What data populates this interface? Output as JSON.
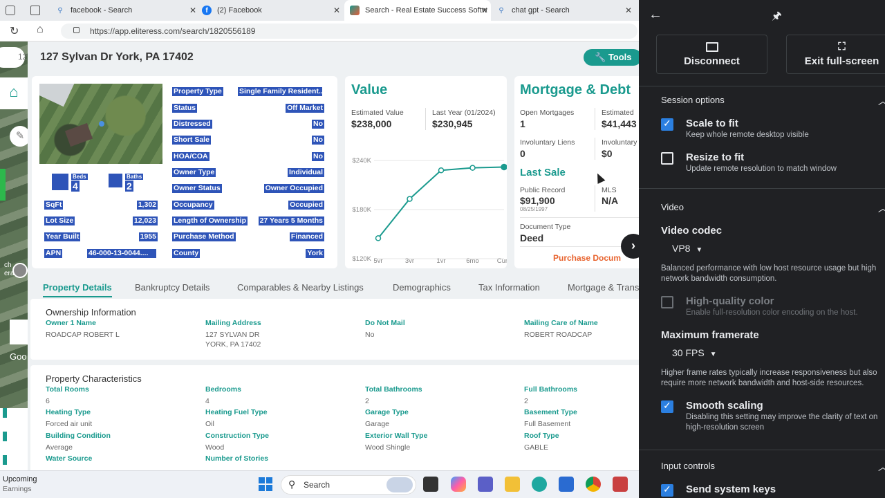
{
  "browser": {
    "tabs": [
      {
        "label": "facebook - Search",
        "icon": "search-icon"
      },
      {
        "label": "(2) Facebook",
        "icon": "facebook-icon"
      },
      {
        "label": "Search - Real Estate Success Softw",
        "icon": "elite-logo-icon"
      },
      {
        "label": "chat gpt - Search",
        "icon": "search-icon"
      }
    ],
    "url": "https://app.eliteress.com/search/1820556189"
  },
  "property": {
    "address": "127 Sylvan Dr York, PA 17402",
    "tools_label": "Tools",
    "beds_label": "Beds",
    "beds": "4",
    "baths_label": "Baths",
    "baths": "2",
    "left_rows": [
      {
        "label": "SqFt",
        "value": "1,302"
      },
      {
        "label": "Lot Size",
        "value": "12,023"
      },
      {
        "label": "Year Built",
        "value": "1955"
      },
      {
        "label": "APN",
        "value": "46-000-13-0044...."
      }
    ],
    "right_rows": [
      {
        "label": "Property Type",
        "value": "Single Family Resident..."
      },
      {
        "label": "Status",
        "value": "Off Market"
      },
      {
        "label": "Distressed",
        "value": "No"
      },
      {
        "label": "Short Sale",
        "value": "No"
      },
      {
        "label": "HOA/COA",
        "value": "No"
      },
      {
        "label": "Owner Type",
        "value": "Individual"
      },
      {
        "label": "Owner Status",
        "value": "Owner Occupied"
      },
      {
        "label": "Occupancy",
        "value": "Occupied"
      },
      {
        "label": "Length of Ownership",
        "value": "27 Years 5 Months"
      },
      {
        "label": "Purchase Method",
        "value": "Financed"
      },
      {
        "label": "County",
        "value": "York"
      }
    ]
  },
  "value_card": {
    "title": "Value",
    "est_label": "Estimated Value",
    "est_value": "$238,000",
    "last_label": "Last Year (01/2024)",
    "last_value": "$230,945"
  },
  "chart_data": {
    "type": "line",
    "categories": [
      "5yr",
      "3yr",
      "1yr",
      "6mo",
      "Curr."
    ],
    "values": [
      145000,
      193000,
      228000,
      231000,
      232000
    ],
    "yticks": [
      "$240K",
      "$180K",
      "$120K"
    ],
    "ylim": [
      120000,
      240000
    ],
    "color": "#1a9a8e"
  },
  "mortgage": {
    "title": "Mortgage & Debt",
    "open_label": "Open Mortgages",
    "open_value": "1",
    "est_label": "Estimated",
    "est_value": "$41,443",
    "inv_liens_label": "Involuntary Liens",
    "inv_liens_value": "0",
    "inv_label": "Involuntary",
    "inv_value": "$0",
    "last_sale_title": "Last Sale",
    "public_label": "Public Record",
    "public_value": "$91,900",
    "public_date": "08/25/1997",
    "mls_label": "MLS",
    "mls_value": "N/A",
    "doc_label": "Document Type",
    "doc_value": "Deed",
    "purchase_link": "Purchase Docum"
  },
  "detail_tabs": [
    "Property Details",
    "Bankruptcy Details",
    "Comparables & Nearby Listings",
    "Demographics",
    "Tax Information",
    "Mortgage & Trans"
  ],
  "ownership": {
    "title": "Ownership Information",
    "fields": [
      {
        "label": "Owner 1 Name",
        "value": "ROADCAP ROBERT L"
      },
      {
        "label": "Mailing Address",
        "value": "127 SYLVAN DR",
        "value2": "YORK, PA 17402"
      },
      {
        "label": "Do Not Mail",
        "value": "No"
      },
      {
        "label": "Mailing Care of Name",
        "value": "ROBERT ROADCAP"
      }
    ]
  },
  "characteristics": {
    "title": "Property Characteristics",
    "fields": [
      {
        "label": "Total Rooms",
        "value": "6"
      },
      {
        "label": "Bedrooms",
        "value": "4"
      },
      {
        "label": "Total Bathrooms",
        "value": "2"
      },
      {
        "label": "Full Bathrooms",
        "value": "2"
      },
      {
        "label": "Heating Type",
        "value": "Forced air unit"
      },
      {
        "label": "Heating Fuel Type",
        "value": "Oil"
      },
      {
        "label": "Garage Type",
        "value": "Garage"
      },
      {
        "label": "Basement Type",
        "value": "Full Basement"
      },
      {
        "label": "Building Condition",
        "value": "Average"
      },
      {
        "label": "Construction Type",
        "value": "Wood"
      },
      {
        "label": "Exterior Wall Type",
        "value": "Wood Shingle"
      },
      {
        "label": "Roof Type",
        "value": "GABLE"
      },
      {
        "label": "Water Source",
        "value": ""
      },
      {
        "label": "Number of Stories",
        "value": ""
      }
    ]
  },
  "left_strip_texts": [
    "12",
    "ch",
    "era",
    "Goo"
  ],
  "taskbar": {
    "widget_title": "Upcoming",
    "widget_sub": "Earnings",
    "search_label": "Search"
  },
  "remote_panel": {
    "disconnect_label": "Disconnect",
    "exit_label": "Exit full-screen",
    "session_title": "Session options",
    "scale_label": "Scale to fit",
    "scale_desc": "Keep whole remote desktop visible",
    "resize_label": "Resize to fit",
    "resize_desc": "Update remote resolution to match window",
    "video_title": "Video",
    "codec_title": "Video codec",
    "codec_value": "VP8",
    "codec_desc1": "Balanced performance with low host resource usage but high",
    "codec_desc2": "network bandwidth consumption.",
    "hq_label": "High-quality color",
    "hq_desc": "Enable full-resolution color encoding on the host.",
    "framerate_title": "Maximum framerate",
    "framerate_value": "30 FPS",
    "fr_desc1": "Higher frame rates typically increase responsiveness but also",
    "fr_desc2": "require more network bandwidth and host-side resources.",
    "smooth_label": "Smooth scaling",
    "smooth_desc1": "Disabling this setting may improve the clarity of text on",
    "smooth_desc2": "high-resolution screen",
    "input_title": "Input controls",
    "syskeys_label": "Send system keys"
  }
}
